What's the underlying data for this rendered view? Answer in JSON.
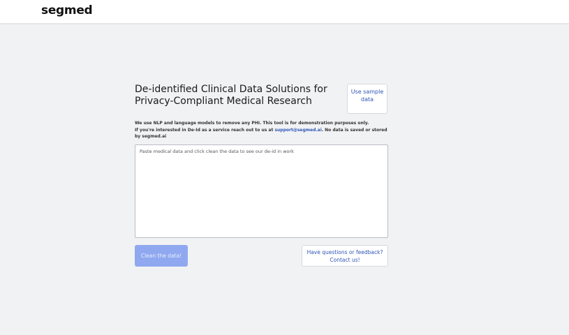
{
  "header": {
    "logo_text": "segmed"
  },
  "main": {
    "title": "De-identified Clinical Data Solutions for Privacy-Compliant Medical Research",
    "sample_button": "Use sample data",
    "info_line1": "We use NLP and language models to remove any PHI. This tool is for demonstration purposes only.",
    "info_line2_prefix": "If you're interested in De-Id as a service reach out to us at",
    "info_email": "support@segmed.ai",
    "info_line2_suffix": ". No data is saved or stored by segmed.ai",
    "textarea_placeholder": "Paste medical data and click clean the data to see our de-id in work",
    "clean_button": "Clean the data!",
    "contact_button": "Have questions or feedback? Contact us!"
  },
  "colors": {
    "accent": "#2f55b6",
    "clean_button_bg": "#8fa8ef",
    "page_bg": "#f1f2f4"
  }
}
